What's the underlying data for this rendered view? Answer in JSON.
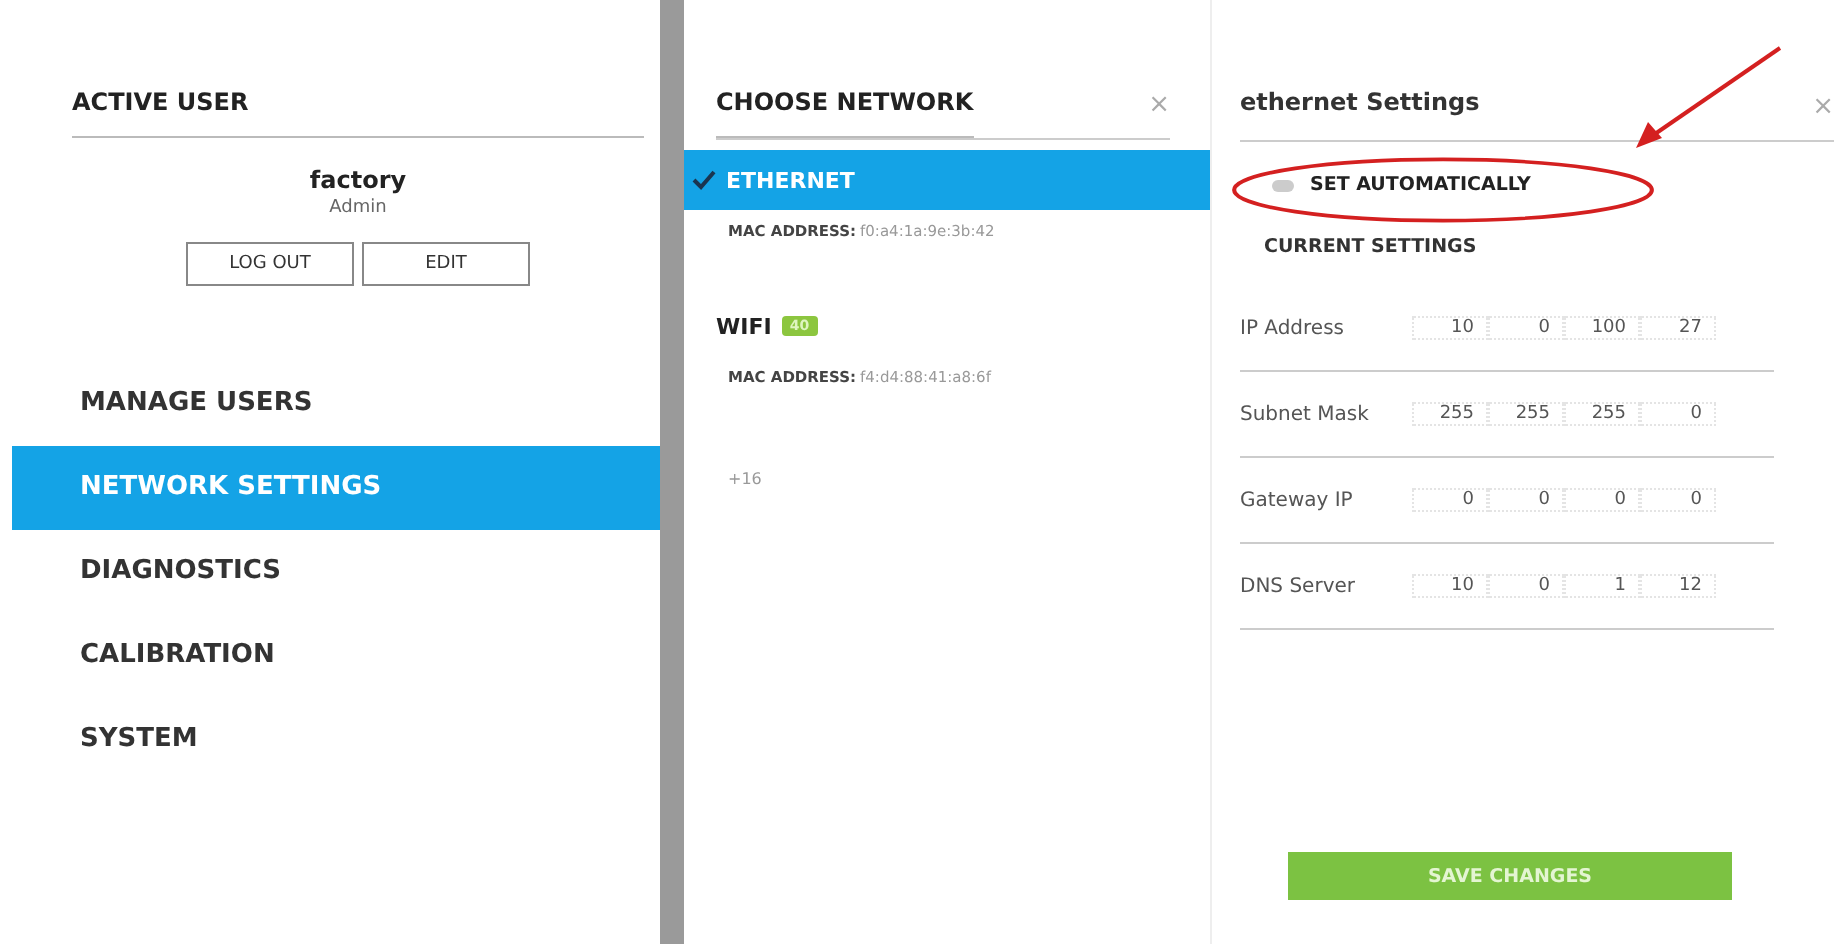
{
  "active_user": {
    "heading": "ACTIVE USER",
    "name": "factory",
    "role": "Admin",
    "buttons": [
      "LOG OUT",
      "EDIT"
    ]
  },
  "menu": [
    {
      "label": "MANAGE USERS",
      "selected": false
    },
    {
      "label": "NETWORK SETTINGS",
      "selected": true
    },
    {
      "label": "DIAGNOSTICS",
      "selected": false
    },
    {
      "label": "CALIBRATION",
      "selected": false
    },
    {
      "label": "SYSTEM",
      "selected": false
    }
  ],
  "choose_network": {
    "heading": "CHOOSE NETWORK",
    "close": "×",
    "networks": [
      {
        "name": "ETHERNET",
        "selected": true,
        "mac_label": "MAC ADDRESS:",
        "mac": "f0:a4:1a:9e:3b:42"
      },
      {
        "name": "WIFI",
        "selected": false,
        "badge": "40",
        "mac_label": "MAC ADDRESS:",
        "mac": "f4:d4:88:41:a8:6f"
      }
    ],
    "footer": "+16"
  },
  "settings": {
    "heading": "ethernet Settings",
    "close": "×",
    "auto": {
      "label": "SET AUTOMATICALLY",
      "on": false
    },
    "subheading": "CURRENT SETTINGS",
    "rows": [
      {
        "label": "IP Address",
        "octets": [
          "10",
          "0",
          "100",
          "27"
        ]
      },
      {
        "label": "Subnet Mask",
        "octets": [
          "255",
          "255",
          "255",
          "0"
        ]
      },
      {
        "label": "Gateway IP",
        "octets": [
          "0",
          "0",
          "0",
          "0"
        ]
      },
      {
        "label": "DNS Server",
        "octets": [
          "10",
          "0",
          "1",
          "12"
        ]
      }
    ],
    "save": "SAVE CHANGES"
  }
}
